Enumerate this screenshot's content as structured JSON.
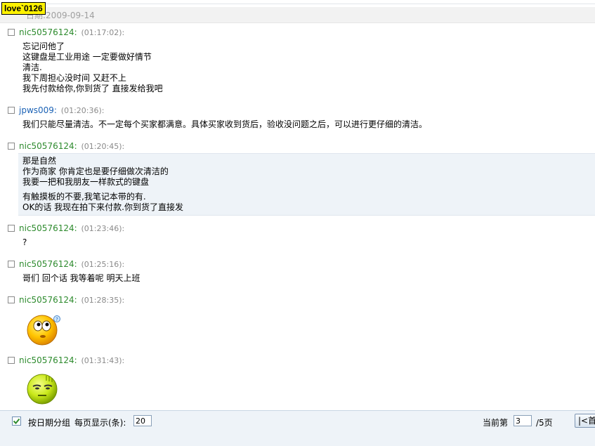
{
  "tag": {
    "label": "love`0126"
  },
  "date_header": {
    "text": "日期:2009-09-14"
  },
  "messages": [
    {
      "sender": "nic50576124:",
      "time": "(01:17:02):",
      "lines": [
        "忘记问他了",
        "这键盘是工业用途 一定要做好情节",
        "清洁.",
        "我下周担心没时间 又赶不上",
        "我先付款给你,你到货了 直接发给我吧"
      ]
    },
    {
      "sender": "jpws009:",
      "time": "(01:20:36):",
      "lines": [
        "我们只能尽量清洁。不一定每个买家都满意。具体买家收到货后，验收没问题之后，可以进行更仔细的清洁。"
      ]
    },
    {
      "sender": "nic50576124:",
      "time": "(01:20:45):",
      "lines": [
        "那是自然",
        "作为商家 你肯定也是要仔细做次清洁的",
        "我要一把和我朋友一样款式的键盘"
      ],
      "lines2": [
        "有触摸板的不要,我笔记本带的有.",
        "OK的话 我现在拍下来付款.你到货了直接发"
      ]
    },
    {
      "sender": "nic50576124:",
      "time": "(01:23:46):",
      "lines": [
        "?"
      ]
    },
    {
      "sender": "nic50576124:",
      "time": "(01:25:16):",
      "lines": [
        "哥们 回个话 我等着呢 明天上班"
      ]
    },
    {
      "sender": "nic50576124:",
      "time": "(01:28:35):",
      "emoticon": "thinking-face"
    },
    {
      "sender": "nic50576124:",
      "time": "(01:31:43):",
      "emoticon": "sick-face"
    }
  ],
  "footer": {
    "group_by_date_label": "按日期分组",
    "per_page_label": "每页显示(条):",
    "per_page_value": "20",
    "current_page_label": "当前第",
    "current_page_value": "3",
    "total_pages_label": "/5页",
    "first_button_label": "|<首页"
  },
  "colors": {
    "sender_green": "#2e8b2e",
    "sender_blue": "#1b62b5",
    "time_gray": "#8a8a8a",
    "footer_bg": "#eef3f8",
    "tag_yellow": "#fff200"
  }
}
